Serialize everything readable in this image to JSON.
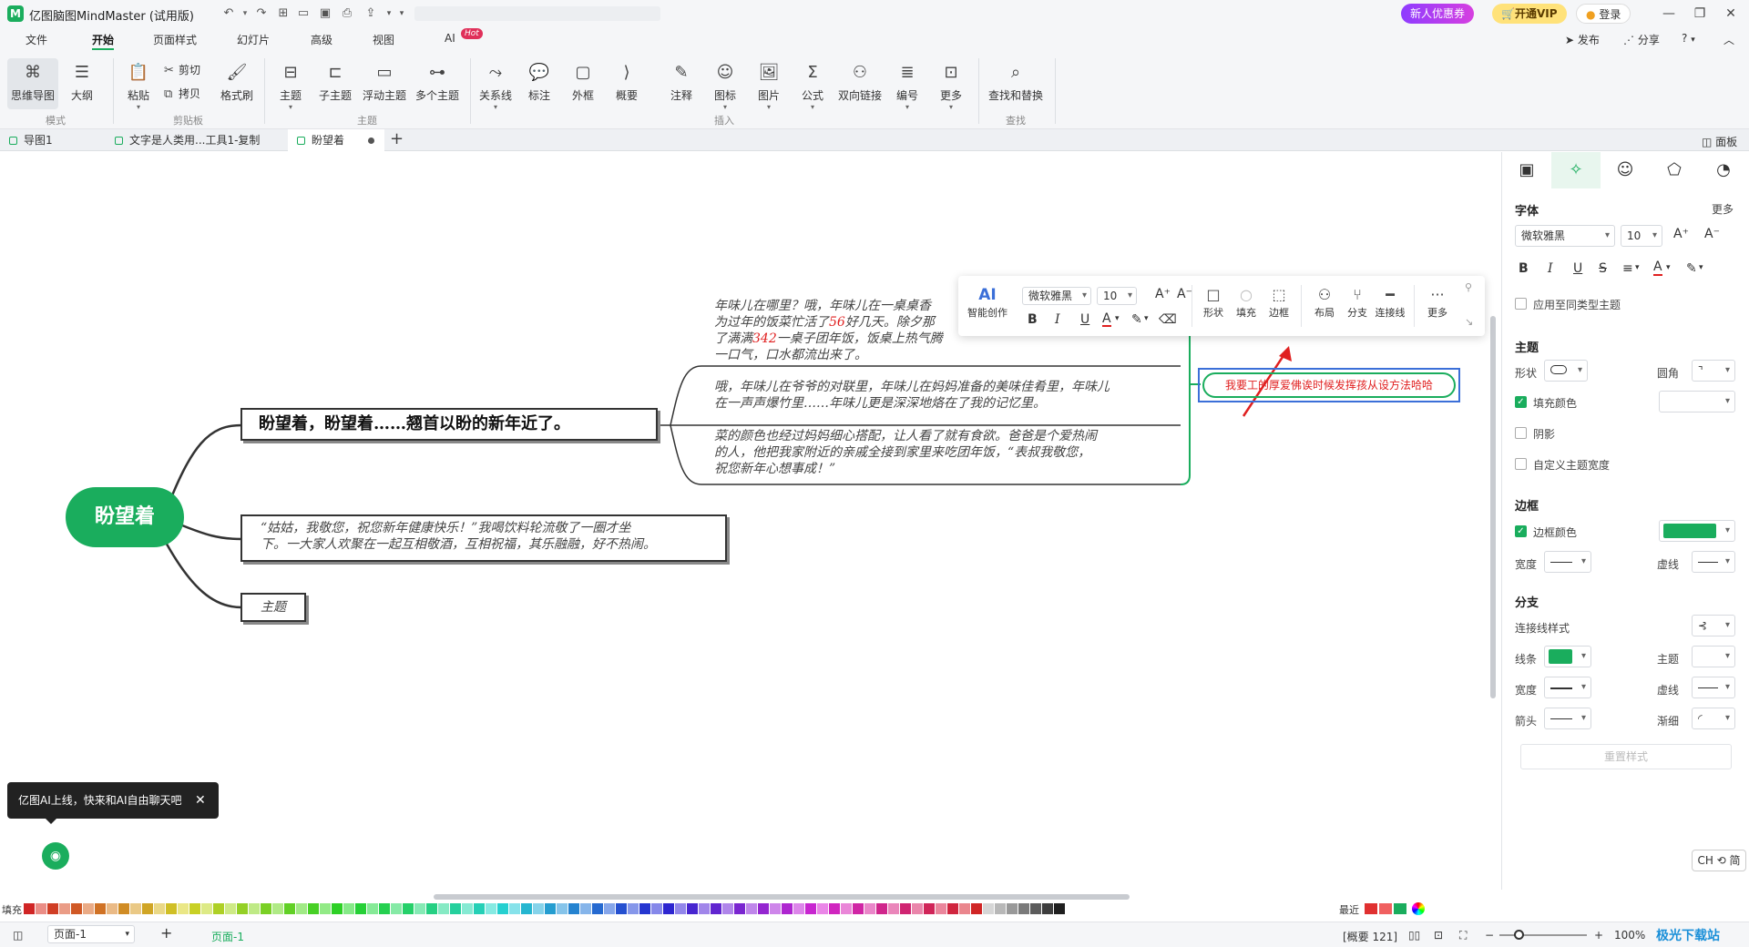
{
  "app": {
    "title": "亿图脑图MindMaster (试用版)",
    "promo_label": "新人优惠券",
    "vip_label": "开通VIP",
    "login_label": "登录",
    "publish_label": "发布",
    "share_label": "分享",
    "help_label": "?"
  },
  "menu": {
    "tabs": [
      "文件",
      "开始",
      "页面样式",
      "幻灯片",
      "高级",
      "视图",
      "AI"
    ],
    "ai_badge": "Hot"
  },
  "ribbon": {
    "mode": {
      "mindmap": "思维导图",
      "outline": "大纲",
      "label": "模式"
    },
    "clipboard": {
      "paste": "粘贴",
      "cut": "剪切",
      "copy": "拷贝",
      "format_painter": "格式刷",
      "label": "剪贴板"
    },
    "topic": {
      "topic": "主题",
      "subtopic": "子主题",
      "floating": "浮动主题",
      "multi": "多个主题",
      "label": "主题"
    },
    "insert": {
      "relation": "关系线",
      "callout": "标注",
      "boundary": "外框",
      "summary": "概要",
      "note": "注释",
      "icon": "图标",
      "image": "图片",
      "formula": "公式",
      "link": "双向链接",
      "numbering": "编号",
      "more": "更多",
      "label": "插入"
    },
    "find": {
      "find_replace": "查找和替换",
      "label": "查找"
    }
  },
  "doctabs": [
    {
      "label": "导图1"
    },
    {
      "label": "文字是人类用...工具1-复制"
    },
    {
      "label": "盼望着"
    }
  ],
  "panel_toggle": "面板",
  "canvas": {
    "central_topic": "盼望着",
    "main_topic": "盼望着，盼望着……翘首以盼的新年近了。",
    "note1_line1": "年味儿在哪里？哦，年味儿在一桌桌香",
    "note1_line2a": "为过年的饭菜忙活了",
    "note1_num1": "56",
    "note1_line2b": "好几天。除夕那",
    "note1_line3a": "了满满",
    "note1_num2": "342",
    "note1_line3b": "一桌子团年饭，饭桌上热气腾",
    "note1_line4": "一口气，口水都流出来了。",
    "note2_line1": "哦，年味儿在爷爷的对联里，年味儿在妈妈准备的美味佳肴里，年味儿",
    "note2_line2": "在一声声爆竹里……年味儿更是深深地烙在了我的记忆里。",
    "note3_line1": "菜的颜色也经过妈妈细心搭配，让人看了就有食欲。爸爸是个爱热闹",
    "note3_line2": "的人，他把我家附近的亲戚全接到家里来吃团年饭，“表叔我敬您，",
    "note3_line3": "祝您新年心想事成！”",
    "topic2_line1": "“姑姑，我敬您，祝您新年健康快乐！”我喝饮料轮流敬了一圈才坐",
    "topic2_line2": "下。一大家人欢聚在一起互相敬酒，互相祝福，其乐融融，好不热闹。",
    "topic3": "主题",
    "editing_topic": "我要工的厚爱佛诶时候发挥孩从设方法哈哈"
  },
  "floatbar": {
    "ai_label": "AI",
    "ai_create": "智能创作",
    "font": "微软雅黑",
    "size": "10",
    "shape": "形状",
    "fill": "填充",
    "border": "边框",
    "layout": "布局",
    "branch": "分支",
    "connector": "连接线",
    "more": "更多"
  },
  "ai_tip": "亿图AI上线，快来和AI自由聊天吧",
  "rpanel": {
    "font_section": "字体",
    "more": "更多",
    "font": "微软雅黑",
    "size": "10",
    "apply_same": "应用至同类型主题",
    "topic_section": "主题",
    "shape": "形状",
    "corner": "圆角",
    "fill_color": "填充颜色",
    "shadow": "阴影",
    "custom_width": "自定义主题宽度",
    "border_section": "边框",
    "border_color": "边框颜色",
    "width": "宽度",
    "dash": "虚线",
    "branch_section": "分支",
    "connector_style": "连接线样式",
    "line": "线条",
    "topic": "主题",
    "width2": "宽度",
    "dash2": "虚线",
    "arrow": "箭头",
    "taper": "渐细",
    "reset": "重置样式"
  },
  "ime": "CH ⟲ 简",
  "palette": {
    "fill_label": "填充",
    "recent_label": "最近"
  },
  "status": {
    "page_select": "页面-1",
    "page_tab": "页面-1",
    "summary": "[概要 121]",
    "zoom": "100%"
  },
  "watermark": "极光下载站",
  "colors": {
    "brand_green": "#1aad5d",
    "accent_red": "#e02020",
    "select_blue": "#3b6fd8"
  }
}
